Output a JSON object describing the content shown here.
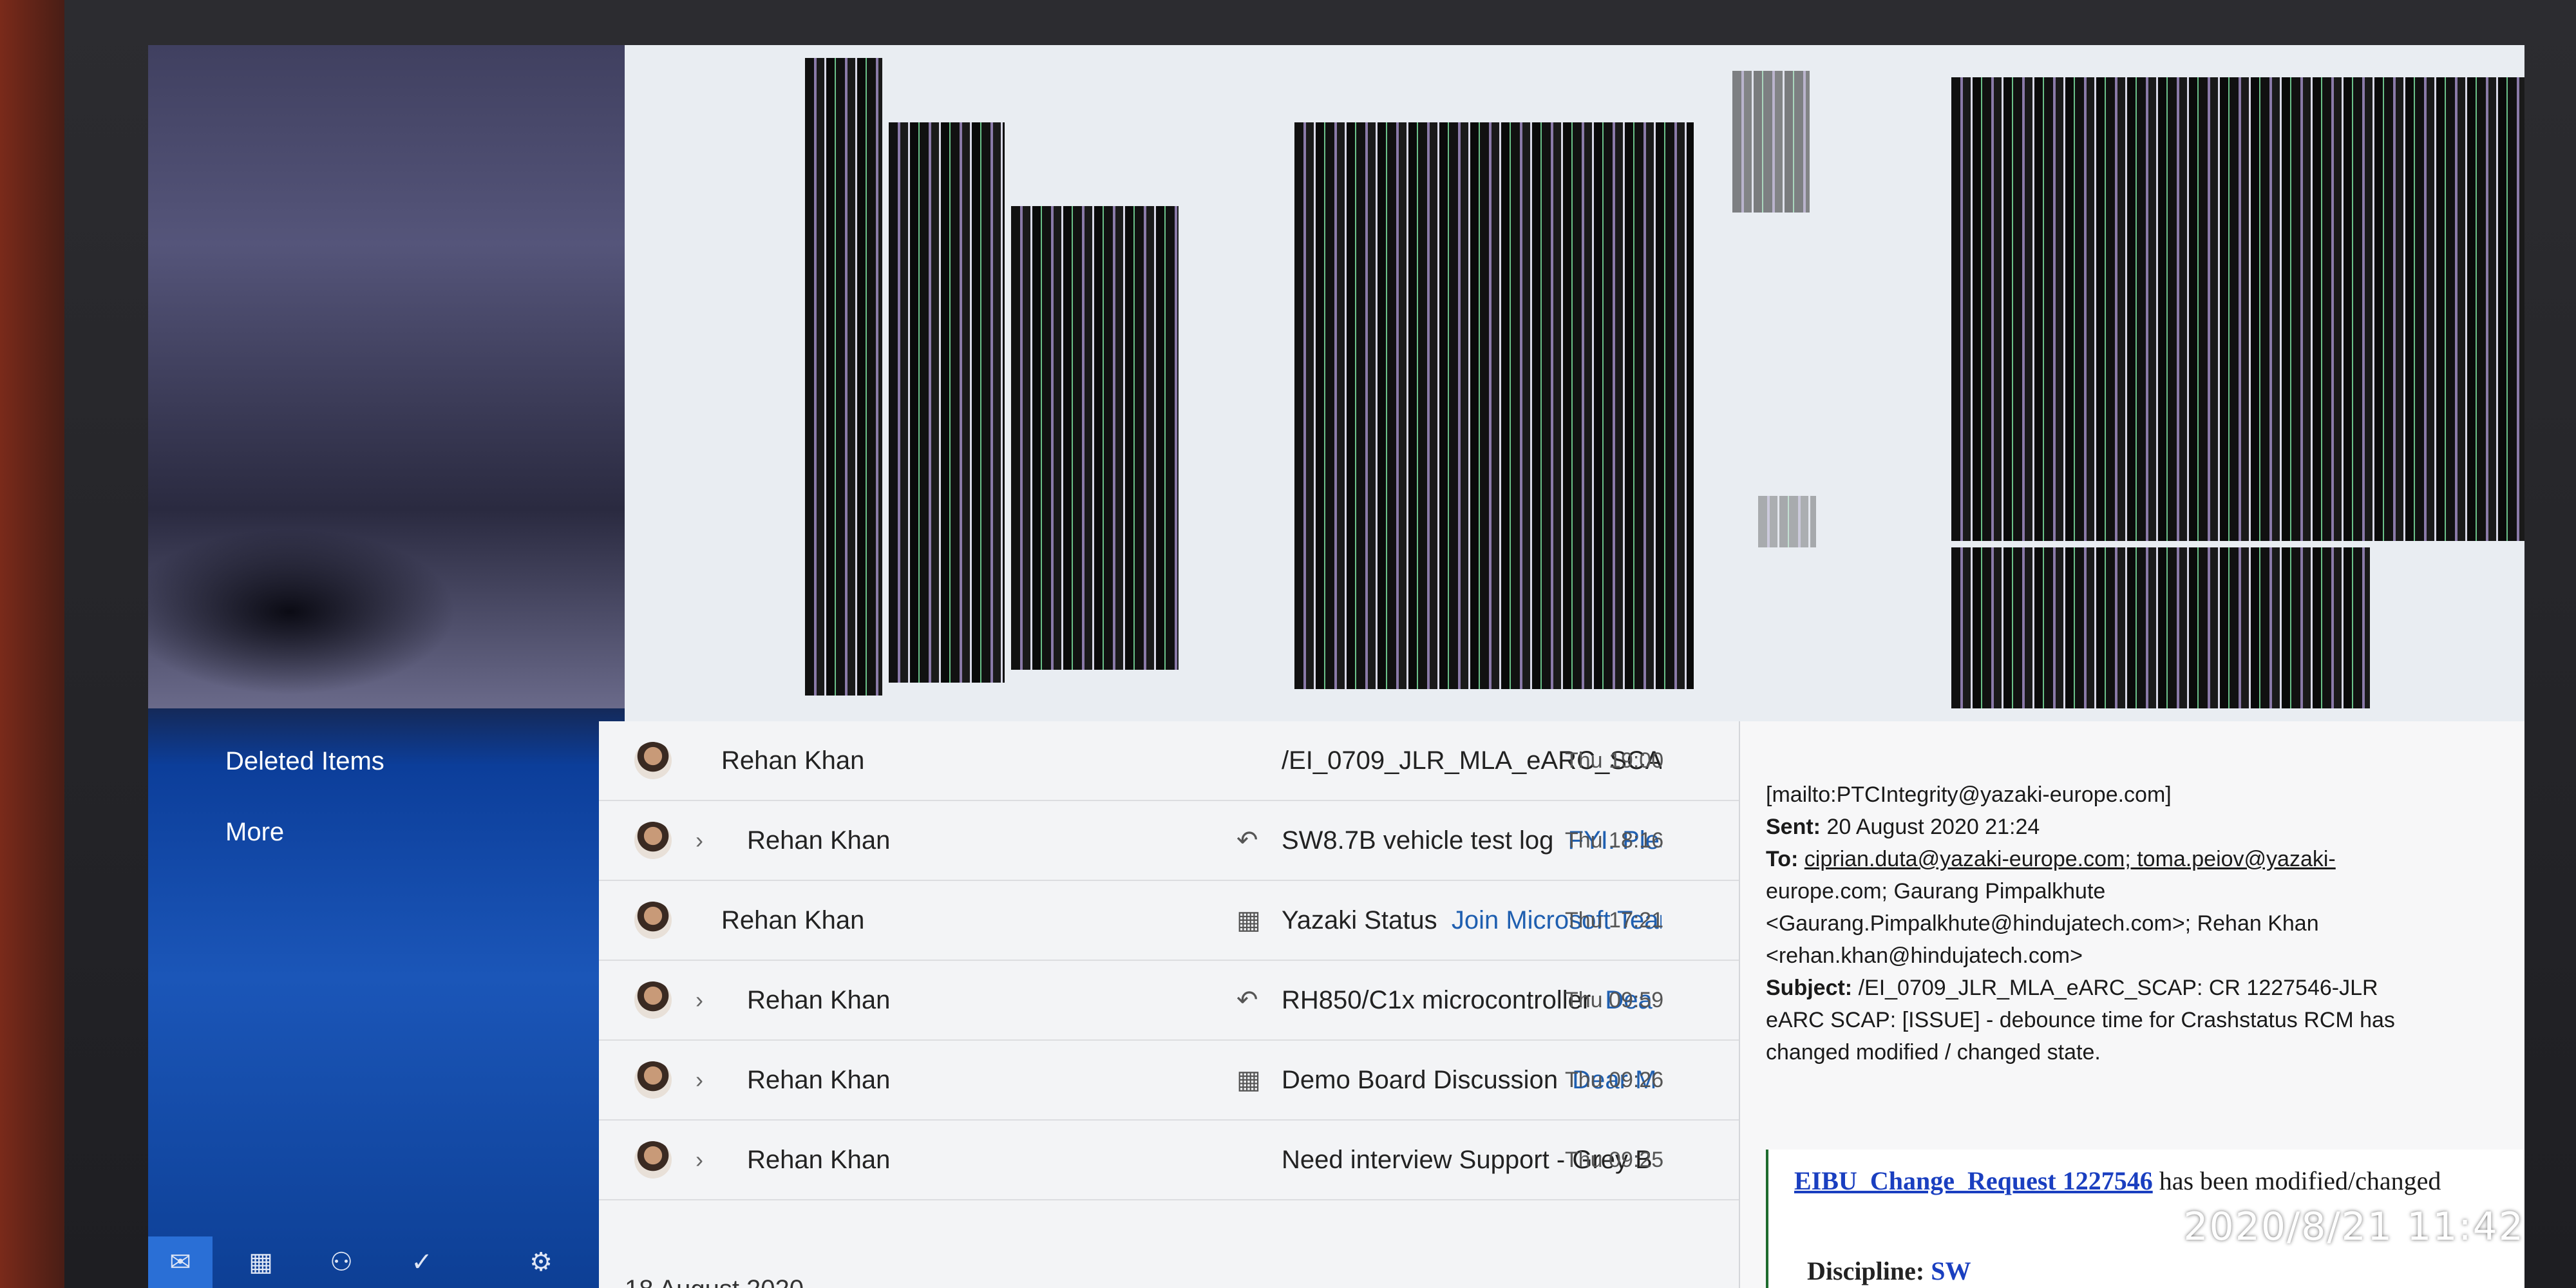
{
  "sidebar": {
    "items": [
      {
        "label": "Deleted Items"
      },
      {
        "label": "More"
      }
    ],
    "nav": [
      {
        "icon": "mail-icon",
        "glyph": "✉"
      },
      {
        "icon": "calendar-icon",
        "glyph": "▦"
      },
      {
        "icon": "people-icon",
        "glyph": "⚇"
      },
      {
        "icon": "todo-icon",
        "glyph": "✓"
      },
      {
        "icon": "settings-icon",
        "glyph": "⚙"
      }
    ]
  },
  "messages": [
    {
      "sender": "Rehan Khan",
      "thread": false,
      "icon": "",
      "subject": "/EI_0709_JLR_MLA_eARC_SCAP: C",
      "preview": "",
      "time": "Thu 19:00"
    },
    {
      "sender": "Rehan Khan",
      "thread": true,
      "icon": "reply-icon",
      "subject": "SW8.7B vehicle test log",
      "preview": "FYI. Plea",
      "time": "Thu 18:16"
    },
    {
      "sender": "Rehan Khan",
      "thread": false,
      "icon": "calendar-icon",
      "subject": "Yazaki Status",
      "preview": "Join Microsoft Tear",
      "time": "Thu 17:21"
    },
    {
      "sender": "Rehan Khan",
      "thread": true,
      "icon": "reply-icon",
      "subject": "RH850/C1x microcontroller",
      "preview": "Dea",
      "time": "Thu 09:59"
    },
    {
      "sender": "Rehan Khan",
      "thread": true,
      "icon": "calendar-icon",
      "subject": "Demo Board Discussion",
      "preview": "Dear M",
      "time": "Thu 09:26"
    },
    {
      "sender": "Rehan Khan",
      "thread": true,
      "icon": "",
      "subject": "Need interview Support - Grey B",
      "preview": "",
      "time": "Thu 09:25"
    }
  ],
  "list_date_header": "18 August 2020",
  "reading": {
    "mailto": "[mailto:PTCIntegrity@yazaki-europe.com]",
    "sent_label": "Sent:",
    "sent_value": " 20 August 2020 21:24",
    "to_label": "To:",
    "to_line1": "ciprian.duta@yazaki-europe.com; toma.peiov@yazaki-",
    "to_line2": "europe.com; Gaurang Pimpalkhute",
    "to_line3": "<Gaurang.Pimpalkhute@hindujatech.com>; Rehan Khan",
    "to_line4": "<rehan.khan@hindujatech.com>",
    "subject_label": "Subject:",
    "subject_line1": " /EI_0709_JLR_MLA_eARC_SCAP: CR 1227546-JLR",
    "subject_line2": "eARC SCAP: [ISSUE] - debounce time for Crashstatus RCM has",
    "subject_line3": "changed modified / changed state.",
    "eibu_link": "EIBU_Change_Request 1227546",
    "eibu_rest": " has been modified/changed",
    "discipline_label": "Discipline:",
    "discipline_value": "SW"
  },
  "timestamp_overlay": "2020/8/21  11:42"
}
